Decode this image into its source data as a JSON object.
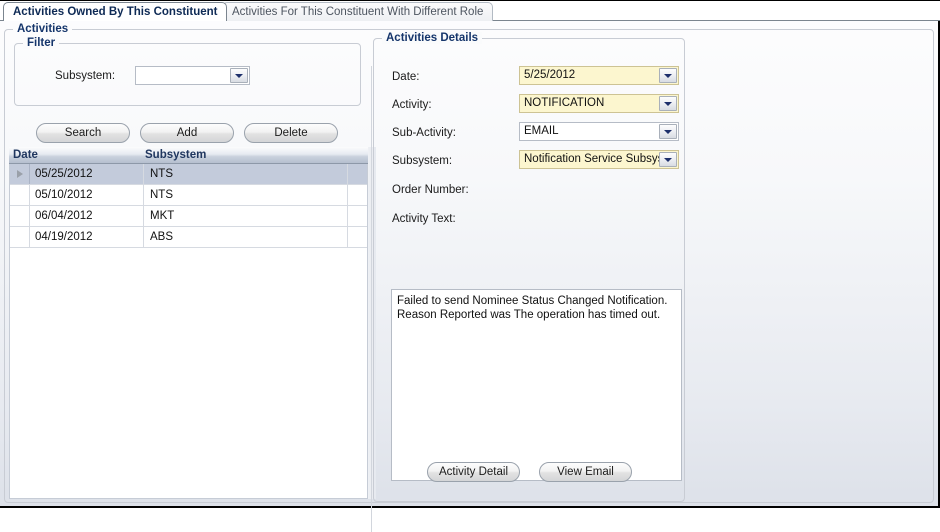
{
  "tabs": [
    {
      "label": "Activities Owned By This Constituent",
      "active": true
    },
    {
      "label": "Activities For This Constituent With Different Role",
      "active": false
    }
  ],
  "groups": {
    "activities_title": "Activities",
    "filter_title": "Filter",
    "details_title": "Activities Details"
  },
  "filter": {
    "subsystem_label": "Subsystem:",
    "subsystem_value": "",
    "subsystem_placeholder": ""
  },
  "action_buttons": {
    "search": "Search",
    "add": "Add",
    "delete": "Delete"
  },
  "grid": {
    "columns": [
      "Date",
      "Subsystem"
    ],
    "rows": [
      {
        "date": "05/25/2012",
        "subsystem": "NTS",
        "selected": true
      },
      {
        "date": "05/10/2012",
        "subsystem": "NTS",
        "selected": false
      },
      {
        "date": "06/04/2012",
        "subsystem": "MKT",
        "selected": false
      },
      {
        "date": "04/19/2012",
        "subsystem": "ABS",
        "selected": false
      }
    ]
  },
  "details": {
    "fields": [
      {
        "label": "Date:",
        "value": "5/25/2012",
        "highlighted": true,
        "has_dropdown": true
      },
      {
        "label": "Activity:",
        "value": "NOTIFICATION",
        "highlighted": true,
        "has_dropdown": true
      },
      {
        "label": "Sub-Activity:",
        "value": "EMAIL",
        "highlighted": false,
        "has_dropdown": true
      },
      {
        "label": "Subsystem:",
        "value": "Notification Service Subsystem",
        "highlighted": true,
        "has_dropdown": true
      }
    ],
    "order_number_label": "Order Number:",
    "order_number_value": "",
    "activity_text_label": "Activity Text:",
    "activity_text_lines": [
      "Failed to send Nominee Status Changed Notification.",
      "Reason Reported was The operation has timed out."
    ],
    "buttons": {
      "activity_detail": "Activity Detail",
      "view_email": "View Email"
    }
  },
  "colors": {
    "highlight_field": "#fcf6cf",
    "selected_row": "#c3cbdb",
    "group_title": "#15356b",
    "grid_header_text": "#20375f"
  }
}
